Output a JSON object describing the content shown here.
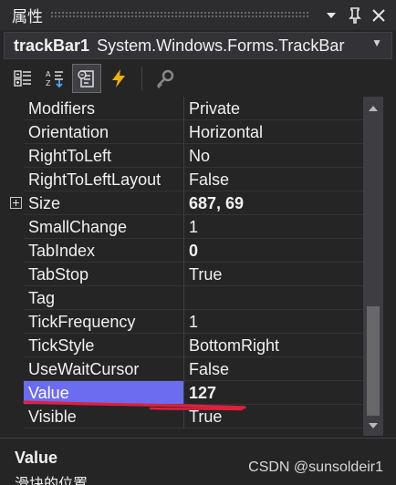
{
  "window": {
    "title": "属性",
    "buttons": {
      "dropdown": "dropdown-arrow-icon",
      "pin": "pin-icon",
      "close": "close-icon"
    }
  },
  "object_selector": {
    "name": "trackBar1",
    "type": "System.Windows.Forms.TrackBar"
  },
  "toolbar": {
    "tools": [
      "categorized-icon",
      "alphabetical-icon",
      "properties-icon",
      "events-icon",
      "property-pages-icon"
    ]
  },
  "properties": [
    {
      "name": "Modifiers",
      "value": "Private"
    },
    {
      "name": "Orientation",
      "value": "Horizontal"
    },
    {
      "name": "RightToLeft",
      "value": "No"
    },
    {
      "name": "RightToLeftLayout",
      "value": "False"
    },
    {
      "name": "Size",
      "value": "687, 69",
      "expandable": true,
      "bold": true
    },
    {
      "name": "SmallChange",
      "value": "1"
    },
    {
      "name": "TabIndex",
      "value": "0",
      "bold": true
    },
    {
      "name": "TabStop",
      "value": "True"
    },
    {
      "name": "Tag",
      "value": ""
    },
    {
      "name": "TickFrequency",
      "value": "1"
    },
    {
      "name": "TickStyle",
      "value": "BottomRight"
    },
    {
      "name": "UseWaitCursor",
      "value": "False"
    },
    {
      "name": "Value",
      "value": "127",
      "bold": true,
      "selected": true
    },
    {
      "name": "Visible",
      "value": "True"
    }
  ],
  "description": {
    "title": "Value",
    "text": "滑块的位置"
  },
  "colors": {
    "background": "#252526",
    "selection": "#6c6cf0",
    "annotation": "#e0203c"
  },
  "watermark": "CSDN @sunsoldeir1"
}
